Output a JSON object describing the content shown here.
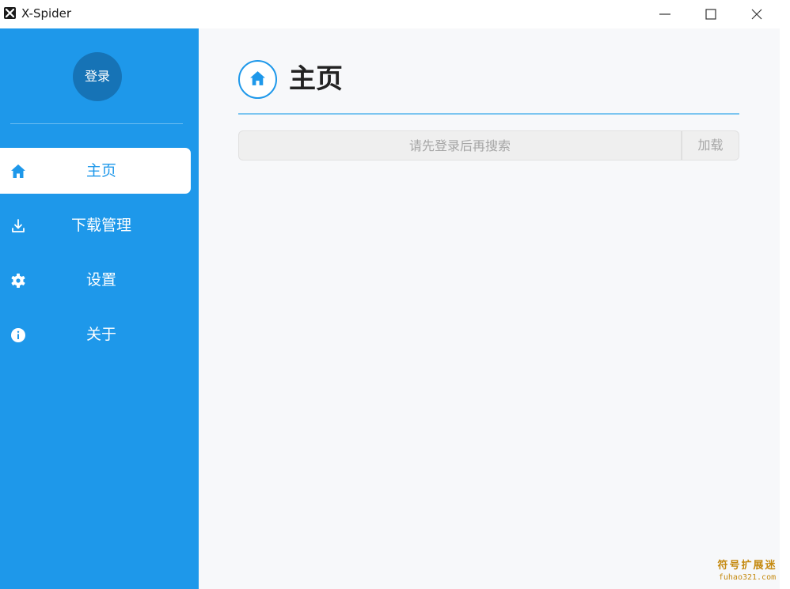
{
  "window": {
    "title": "X-Spider",
    "controls": [
      "minimize-icon",
      "maximize-icon",
      "close-icon"
    ]
  },
  "sidebar": {
    "avatar_label": "登录",
    "items": [
      {
        "label": "主页",
        "icon": "home-icon",
        "active": true
      },
      {
        "label": "下载管理",
        "icon": "download-icon",
        "active": false
      },
      {
        "label": "设置",
        "icon": "gear-icon",
        "active": false
      },
      {
        "label": "关于",
        "icon": "info-icon",
        "active": false
      }
    ]
  },
  "main": {
    "page_title": "主页",
    "page_icon": "home-icon",
    "search": {
      "placeholder": "请先登录后再搜索",
      "value": ""
    },
    "load_button_label": "加载"
  },
  "watermark": {
    "line1": "符号扩展迷",
    "line2": "fuhao321.com"
  },
  "colors": {
    "sidebar": "#1e98ea",
    "accent": "#1e98ea",
    "avatar": "#1673b6",
    "content_bg": "#f7f8fa"
  }
}
